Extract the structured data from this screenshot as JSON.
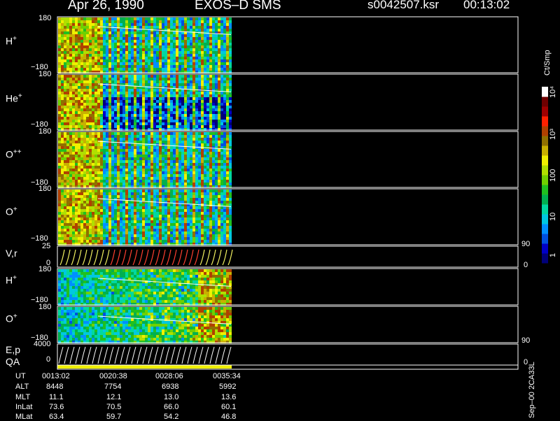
{
  "header": {
    "date": "Apr 26, 1990",
    "instrument": "EXOS–D SMS",
    "file": "s0042507.ksr",
    "time": "00:13:02"
  },
  "panels": [
    {
      "label_base": "H",
      "label_sup": "+",
      "ticks": [
        "180",
        "−180"
      ]
    },
    {
      "label_base": "He",
      "label_sup": "+",
      "ticks": [
        "180",
        "−180"
      ]
    },
    {
      "label_base": "O",
      "label_sup": "++",
      "ticks": [
        "180",
        "−180"
      ]
    },
    {
      "label_base": "O",
      "label_sup": "+",
      "ticks": [
        "180",
        "−180"
      ]
    },
    {
      "label_base": "V,r",
      "label_sup": "",
      "ticks": [
        "25",
        "0"
      ],
      "right_ticks": [
        "90",
        "0"
      ]
    },
    {
      "label_base": "H",
      "label_sup": "+",
      "ticks": [
        "180",
        "−180"
      ]
    },
    {
      "label_base": "O",
      "label_sup": "+",
      "ticks": [
        "180",
        "−180"
      ]
    },
    {
      "label_base": "E,p",
      "label_sup": "",
      "ticks": [
        "4000",
        "0"
      ],
      "right_ticks": [
        "90",
        "0"
      ]
    },
    {
      "label_base": "QA",
      "label_sup": "",
      "ticks": []
    }
  ],
  "colorbar": {
    "unit": "Ct/Smp",
    "ticks": [
      "1",
      "10",
      "100",
      "10³",
      "10⁴"
    ],
    "colors": [
      "#00007a",
      "#0000c8",
      "#0050e0",
      "#0090ff",
      "#00c8e0",
      "#00d8a0",
      "#00b050",
      "#20c020",
      "#70d000",
      "#b0e000",
      "#f0f000",
      "#c8b000",
      "#907000",
      "#b04000",
      "#ff2000",
      "#a00000",
      "#700000",
      "#ffffff"
    ]
  },
  "ephemeris": {
    "labels": [
      "UT",
      "ALT",
      "MLT",
      "InLat",
      "MLat"
    ],
    "columns": [
      [
        "0013:02",
        "8448",
        "11.1",
        "73.6",
        "63.4"
      ],
      [
        "0020:38",
        "7754",
        "12.1",
        "70.5",
        "59.7"
      ],
      [
        "0028:06",
        "6938",
        "13.0",
        "66.0",
        "54.2"
      ],
      [
        "0035:34",
        "5992",
        "13.6",
        "60.1",
        "46.8"
      ]
    ]
  },
  "footer_code": "Sep–00 2CA33L"
}
